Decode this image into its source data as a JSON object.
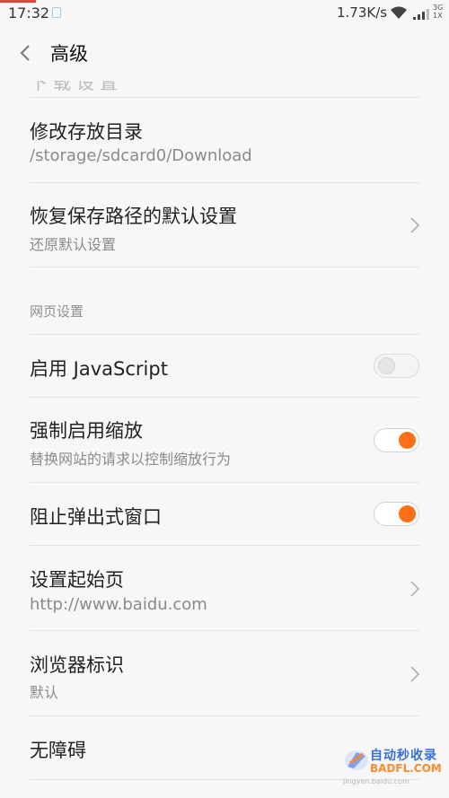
{
  "status_bar": {
    "time": "17:32",
    "speed": "1.73K/s",
    "net_type_top": "3G",
    "net_type_bottom": "1X",
    "icons": [
      "notification-icon",
      "wifi-icon",
      "signal-icon"
    ]
  },
  "header": {
    "title": "高级",
    "back_icon": "chevron-left-icon"
  },
  "items": {
    "partial": "下载设置",
    "storage_dir": {
      "title": "修改存放目录",
      "value": "/storage/sdcard0/Download"
    },
    "restore_path": {
      "title": "恢复保存路径的默认设置",
      "subtitle": "还原默认设置"
    },
    "web_section": "网页设置",
    "javascript": {
      "title": "启用 JavaScript",
      "enabled": false
    },
    "force_zoom": {
      "title": "强制启用缩放",
      "subtitle": "替换网站的请求以控制缩放行为",
      "enabled": true
    },
    "block_popups": {
      "title": "阻止弹出式窗口",
      "enabled": true
    },
    "home_page": {
      "title": "设置起始页",
      "value": "http://www.baidu.com"
    },
    "user_agent": {
      "title": "浏览器标识",
      "value": "默认"
    },
    "accessibility": {
      "title": "无障碍"
    }
  },
  "watermark": {
    "line1": "自动秒收录",
    "line2": "BADFL.COM",
    "url": "jingyan.baidu.com"
  },
  "colors": {
    "accent": "#ff6f15",
    "background": "#f7f7f7",
    "divider": "#e3e3e3",
    "status_accent": "#e2473b"
  }
}
